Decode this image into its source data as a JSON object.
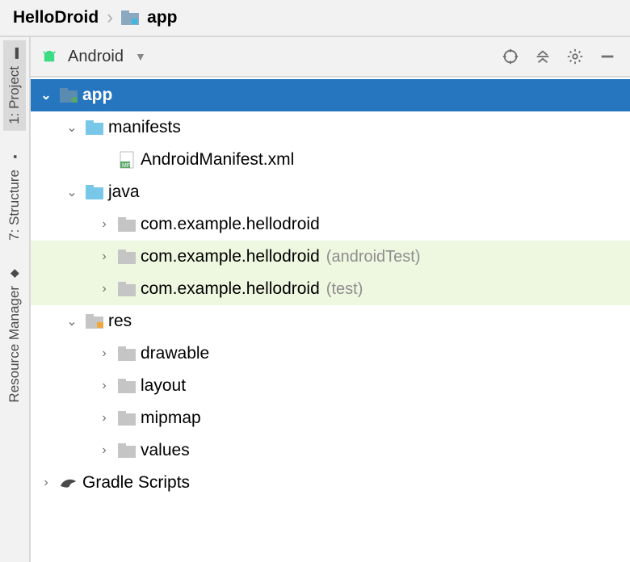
{
  "breadcrumb": {
    "root": "HelloDroid",
    "leaf": "app"
  },
  "rail": {
    "project": "1: Project",
    "structure": "7: Structure",
    "resManager": "Resource Manager"
  },
  "panel": {
    "mode": "Android"
  },
  "tree": {
    "app": "app",
    "manifests": "manifests",
    "manifestFile": "AndroidManifest.xml",
    "java": "java",
    "pkgMain": "com.example.hellodroid",
    "pkgAndroidTest": "com.example.hellodroid",
    "pkgAndroidTestSuffix": "(androidTest)",
    "pkgTest": "com.example.hellodroid",
    "pkgTestSuffix": "(test)",
    "res": "res",
    "drawable": "drawable",
    "layout": "layout",
    "mipmap": "mipmap",
    "values": "values",
    "gradle": "Gradle Scripts"
  }
}
